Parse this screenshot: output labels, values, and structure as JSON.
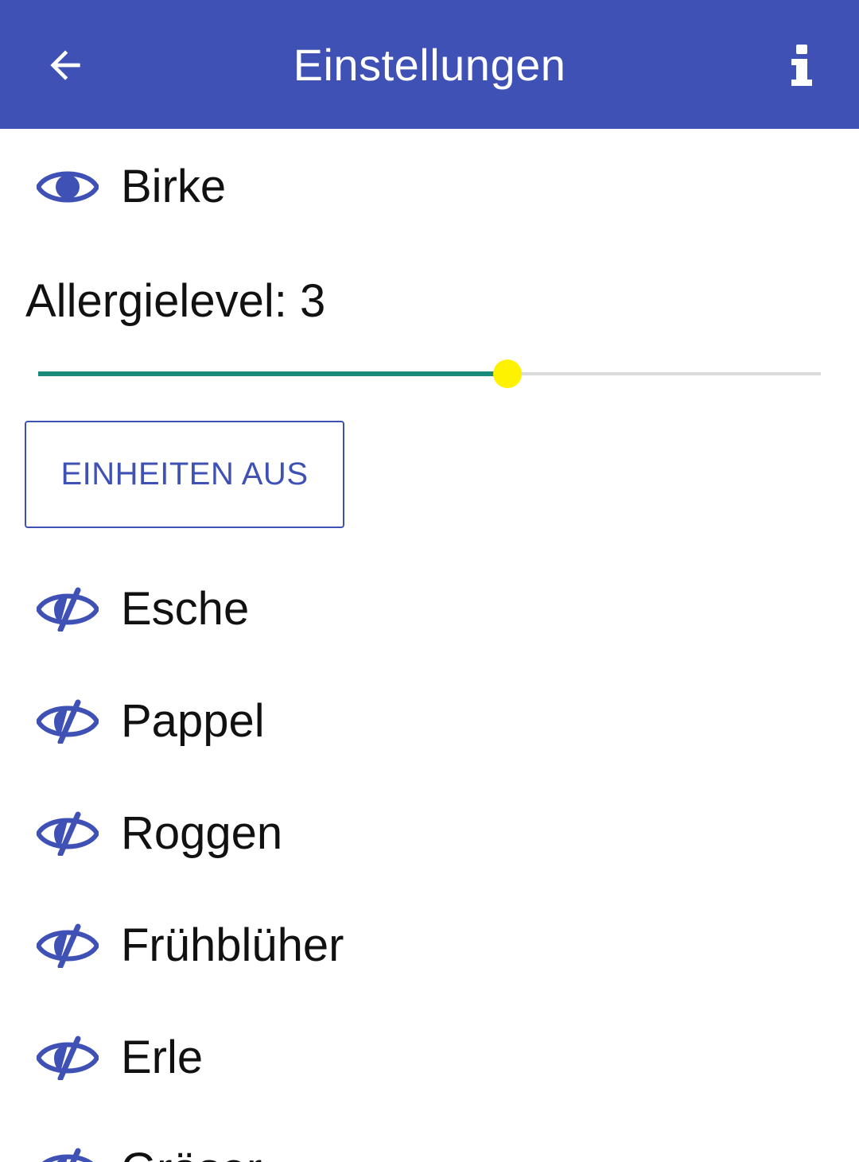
{
  "appbar": {
    "title": "Einstellungen",
    "back_icon": "arrow-left-icon",
    "info_icon": "info-icon",
    "background": "#3F51B5"
  },
  "selected_plant": {
    "name": "Birke",
    "icon": "eye-icon",
    "visible": true
  },
  "allergy_level": {
    "label": "Allergielevel: 3",
    "value": 3,
    "min": 0,
    "max": 5,
    "fill_color": "#1A8A7D",
    "thumb_color": "#FFF200"
  },
  "units_button": {
    "label": "EINHEITEN AUS"
  },
  "plants": [
    {
      "name": "Esche",
      "icon": "eye-off-icon",
      "visible": false
    },
    {
      "name": "Pappel",
      "icon": "eye-off-icon",
      "visible": false
    },
    {
      "name": "Roggen",
      "icon": "eye-off-icon",
      "visible": false
    },
    {
      "name": "Frühblüher",
      "icon": "eye-off-icon",
      "visible": false
    },
    {
      "name": "Erle",
      "icon": "eye-off-icon",
      "visible": false
    },
    {
      "name": "Gräser",
      "icon": "eye-off-icon",
      "visible": false
    }
  ],
  "accent_color": "#3F51B5"
}
